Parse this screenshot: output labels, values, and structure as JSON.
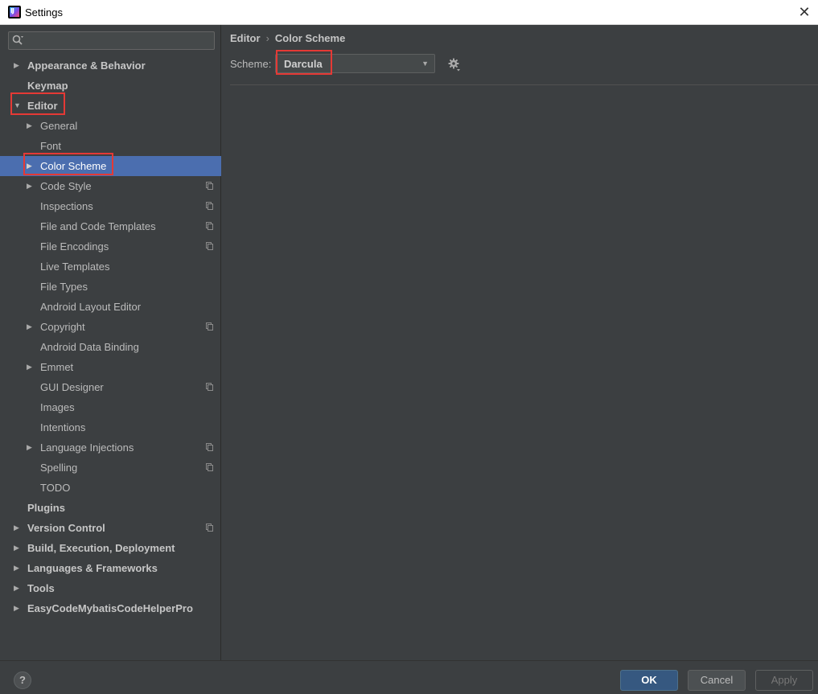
{
  "window": {
    "title": "Settings"
  },
  "search": {
    "placeholder": ""
  },
  "tree": [
    {
      "label": "Appearance & Behavior",
      "level": 1,
      "expandable": true,
      "expanded": false
    },
    {
      "label": "Keymap",
      "level": 1,
      "expandable": false
    },
    {
      "label": "Editor",
      "level": 1,
      "expandable": true,
      "expanded": true,
      "highlighted": true
    },
    {
      "label": "General",
      "level": 2,
      "expandable": true,
      "expanded": false
    },
    {
      "label": "Font",
      "level": 2,
      "expandable": false
    },
    {
      "label": "Color Scheme",
      "level": 2,
      "expandable": true,
      "expanded": false,
      "selected": true,
      "highlighted": true
    },
    {
      "label": "Code Style",
      "level": 2,
      "expandable": true,
      "expanded": false,
      "copy_icon": true
    },
    {
      "label": "Inspections",
      "level": 2,
      "expandable": false,
      "copy_icon": true
    },
    {
      "label": "File and Code Templates",
      "level": 2,
      "expandable": false,
      "copy_icon": true
    },
    {
      "label": "File Encodings",
      "level": 2,
      "expandable": false,
      "copy_icon": true
    },
    {
      "label": "Live Templates",
      "level": 2,
      "expandable": false
    },
    {
      "label": "File Types",
      "level": 2,
      "expandable": false
    },
    {
      "label": "Android Layout Editor",
      "level": 2,
      "expandable": false
    },
    {
      "label": "Copyright",
      "level": 2,
      "expandable": true,
      "expanded": false,
      "copy_icon": true
    },
    {
      "label": "Android Data Binding",
      "level": 2,
      "expandable": false
    },
    {
      "label": "Emmet",
      "level": 2,
      "expandable": true,
      "expanded": false
    },
    {
      "label": "GUI Designer",
      "level": 2,
      "expandable": false,
      "copy_icon": true
    },
    {
      "label": "Images",
      "level": 2,
      "expandable": false
    },
    {
      "label": "Intentions",
      "level": 2,
      "expandable": false
    },
    {
      "label": "Language Injections",
      "level": 2,
      "expandable": true,
      "expanded": false,
      "copy_icon": true
    },
    {
      "label": "Spelling",
      "level": 2,
      "expandable": false,
      "copy_icon": true
    },
    {
      "label": "TODO",
      "level": 2,
      "expandable": false
    },
    {
      "label": "Plugins",
      "level": 1,
      "expandable": false
    },
    {
      "label": "Version Control",
      "level": 1,
      "expandable": true,
      "expanded": false,
      "copy_icon": true
    },
    {
      "label": "Build, Execution, Deployment",
      "level": 1,
      "expandable": true,
      "expanded": false
    },
    {
      "label": "Languages & Frameworks",
      "level": 1,
      "expandable": true,
      "expanded": false
    },
    {
      "label": "Tools",
      "level": 1,
      "expandable": true,
      "expanded": false
    },
    {
      "label": "EasyCodeMybatisCodeHelperPro",
      "level": 1,
      "expandable": true,
      "expanded": false
    }
  ],
  "breadcrumb": {
    "parent": "Editor",
    "separator": "›",
    "current": "Color Scheme"
  },
  "scheme": {
    "label": "Scheme:",
    "value": "Darcula"
  },
  "buttons": {
    "help": "?",
    "ok": "OK",
    "cancel": "Cancel",
    "apply": "Apply"
  },
  "colors": {
    "background": "#3c3f41",
    "selection": "#4b6eaf",
    "highlight_box": "#e53935",
    "ok_button": "#365880"
  },
  "icons": {
    "search": "search-icon",
    "gear": "gear-icon",
    "copy": "copy-icon",
    "collapsed": "chevron-right-icon",
    "expanded": "chevron-down-icon"
  }
}
